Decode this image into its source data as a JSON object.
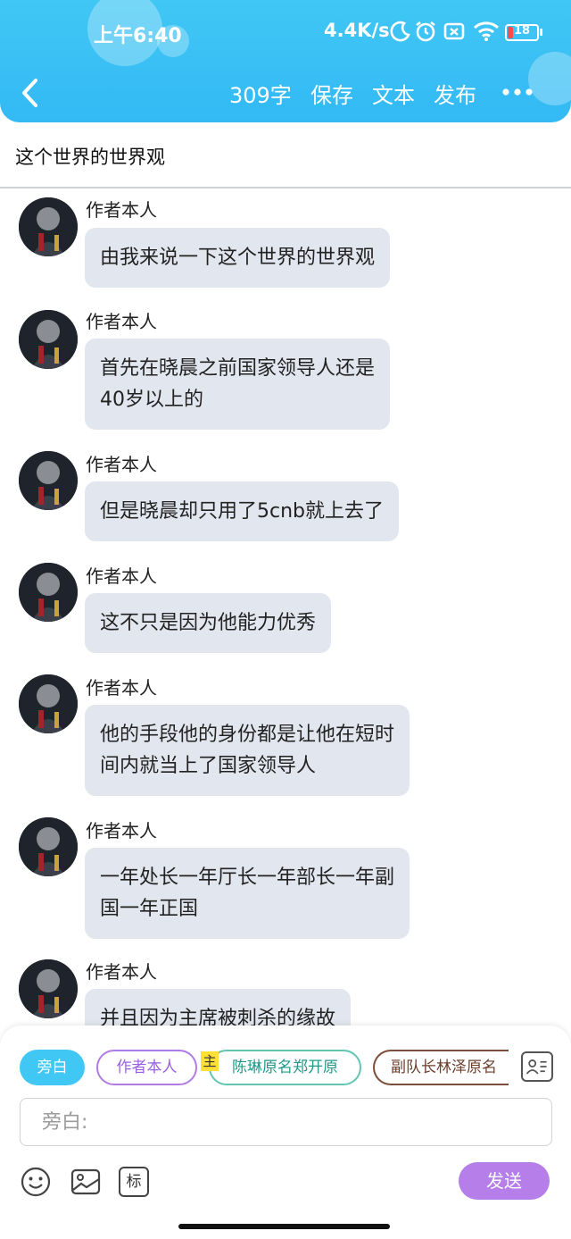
{
  "status_bar": {
    "time": "上午6:40",
    "network_speed": "4.4K/s",
    "battery": "18",
    "battery_level": 0.18,
    "icons": [
      "moon-icon",
      "alarm-icon",
      "sim-off-icon",
      "wifi-icon",
      "battery-icon"
    ]
  },
  "nav": {
    "back_icon": "chevron-left-icon",
    "word_count": "309字",
    "save": "保存",
    "text": "文本",
    "publish": "发布",
    "more_icon": "more-horizontal-icon"
  },
  "chapter_title": "这个世界的世界观",
  "messages": [
    {
      "speaker": "作者本人",
      "text": "由我来说一下这个世界的世界观"
    },
    {
      "speaker": "作者本人",
      "text": "首先在晓晨之前国家领导人还是\n40岁以上的"
    },
    {
      "speaker": "作者本人",
      "text": "但是晓晨却只用了5cnb就上去了"
    },
    {
      "speaker": "作者本人",
      "text": "这不只是因为他能力优秀"
    },
    {
      "speaker": "作者本人",
      "text": "他的手段他的身份都是让他在短时\n间内就当上了国家领导人"
    },
    {
      "speaker": "作者本人",
      "text": "一年处长一年厅长一年部长一年副\n国一年正国"
    },
    {
      "speaker": "作者本人",
      "text": "并且因为主席被刺杀的缘故"
    }
  ],
  "composer": {
    "roles": [
      {
        "label": "旁白",
        "active": true
      },
      {
        "label": "作者本人",
        "active": false
      },
      {
        "label": "陈琳原名郑开原",
        "active": false,
        "tag": "主"
      },
      {
        "label": "副队长林泽原名",
        "active": false
      }
    ],
    "input_placeholder": "旁白:",
    "send": "发送",
    "tool_label_tag": "标",
    "icons": [
      "contact-card-icon",
      "emoji-icon",
      "image-icon",
      "tag-icon"
    ]
  },
  "colors": {
    "header": "#41c7f4",
    "bubble": "#e2e6ee",
    "send_button": "#b57ee9",
    "active_chip": "#41c7f4"
  }
}
